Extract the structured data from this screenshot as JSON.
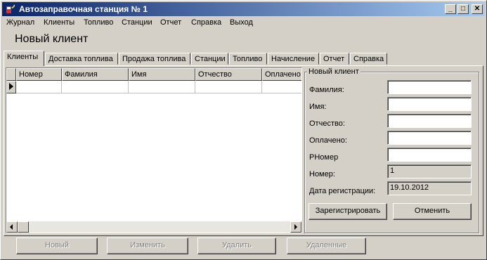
{
  "window": {
    "title": "Автозаправочная станция № 1",
    "controls": {
      "minimize": "_",
      "maximize": "□",
      "close": "✕"
    }
  },
  "menu": [
    "Журнал",
    "Клиенты",
    "Топливо",
    "Станции",
    "Отчет",
    "Справка",
    "Выход"
  ],
  "header": {
    "title": "Новый клиент"
  },
  "tabs": [
    "Клиенты",
    "Доставка топлива",
    "Продажа топлива",
    "Станции",
    "Топливо",
    "Начисление",
    "Отчет",
    "Справка"
  ],
  "active_tab": "Клиенты",
  "grid": {
    "columns": [
      "Номер",
      "Фамилия",
      "Имя",
      "Отчество",
      "Оплачено"
    ],
    "rows": [
      [
        "",
        "",
        "",
        "",
        ""
      ]
    ]
  },
  "form": {
    "legend": "Новый клиент",
    "fields": [
      {
        "label": "Фамилия:",
        "value": ""
      },
      {
        "label": "Имя:",
        "value": ""
      },
      {
        "label": "Отчество:",
        "value": ""
      },
      {
        "label": "Оплачено:",
        "value": ""
      },
      {
        "label": "PHомер",
        "value": ""
      }
    ],
    "readonly": [
      {
        "label": "Номер:",
        "value": "1"
      },
      {
        "label": "Дата регистрации:",
        "value": "19.10.2012"
      }
    ],
    "buttons": {
      "register": "Зарегистрировать",
      "cancel": "Отменить"
    }
  },
  "bottom_buttons": [
    "Новый",
    "Изменить",
    "Удалить",
    "Удаленные"
  ]
}
